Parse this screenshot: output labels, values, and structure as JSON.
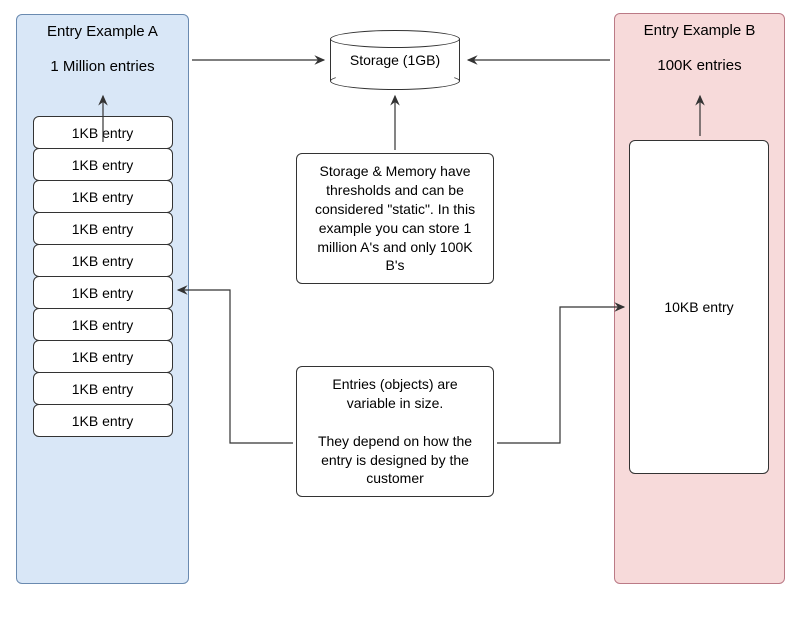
{
  "panelA": {
    "title": "Entry Example A",
    "subtitle": "1 Million entries",
    "entries": [
      "1KB entry",
      "1KB entry",
      "1KB entry",
      "1KB entry",
      "1KB entry",
      "1KB entry",
      "1KB entry",
      "1KB entry",
      "1KB entry",
      "1KB entry"
    ]
  },
  "panelB": {
    "title": "Entry Example B",
    "subtitle": "100K entries",
    "entryLabel": "10KB entry"
  },
  "storage": {
    "label": "Storage (1GB)"
  },
  "noteStorage": "Storage & Memory have thresholds and can be considered \"static\".  In this example you can store 1 million A's and only 100K B's",
  "noteEntries": "Entries (objects) are variable in size.\n\nThey depend on how the entry is designed by the customer"
}
